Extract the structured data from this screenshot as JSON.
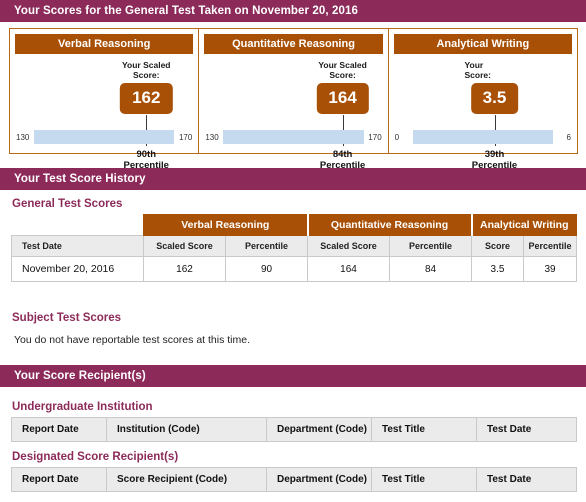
{
  "header": {
    "title": "Your Scores for the General Test Taken on November 20, 2016"
  },
  "score_cards": [
    {
      "title": "Verbal Reasoning",
      "caption": "Your Scaled\nScore:",
      "score": "162",
      "scale_min": "130",
      "scale_max": "170",
      "percentile": "90th\nPercentile"
    },
    {
      "title": "Quantitative Reasoning",
      "caption": "Your Scaled\nScore:",
      "score": "164",
      "scale_min": "130",
      "scale_max": "170",
      "percentile": "84th\nPercentile"
    },
    {
      "title": "Analytical Writing",
      "caption": "Your\nScore:",
      "score": "3.5",
      "scale_min": "0",
      "scale_max": "6",
      "percentile": "39th\nPercentile"
    }
  ],
  "history_section": {
    "bar_title": "Your Test Score History",
    "subhead": "General Test Scores",
    "group_headers": [
      "Verbal Reasoning",
      "Quantitative Reasoning",
      "Analytical Writing"
    ],
    "column_headers": [
      "Test Date",
      "Scaled Score",
      "Percentile",
      "Scaled Score",
      "Percentile",
      "Score",
      "Percentile"
    ],
    "rows": [
      [
        "November 20, 2016",
        "162",
        "90",
        "164",
        "84",
        "3.5",
        "39"
      ]
    ]
  },
  "subject_section": {
    "subhead": "Subject Test Scores",
    "message": "You do not have reportable test scores at this time."
  },
  "recipients_section": {
    "bar_title": "Your Score Recipient(s)",
    "undergraduate": {
      "subhead": "Undergraduate Institution",
      "column_headers": [
        "Report Date",
        "Institution (Code)",
        "Department (Code)",
        "Test Title",
        "Test Date"
      ]
    },
    "designated": {
      "subhead": "Designated Score Recipient(s)",
      "column_headers": [
        "Report Date",
        "Score Recipient (Code)",
        "Department (Code)",
        "Test Title",
        "Test Date"
      ]
    }
  },
  "chart_data": {
    "type": "bar",
    "title": "GRE General Test Scores — November 20, 2016",
    "categories": [
      "Verbal Reasoning",
      "Quantitative Reasoning",
      "Analytical Writing"
    ],
    "series": [
      {
        "name": "Score",
        "values": [
          162,
          164,
          3.5
        ]
      },
      {
        "name": "Percentile",
        "values": [
          90,
          84,
          39
        ]
      }
    ],
    "axis_ranges": [
      [
        130,
        170
      ],
      [
        130,
        170
      ],
      [
        0,
        6
      ]
    ],
    "xlabel": "",
    "ylabel": "Score",
    "grid": false,
    "legend": "none"
  }
}
